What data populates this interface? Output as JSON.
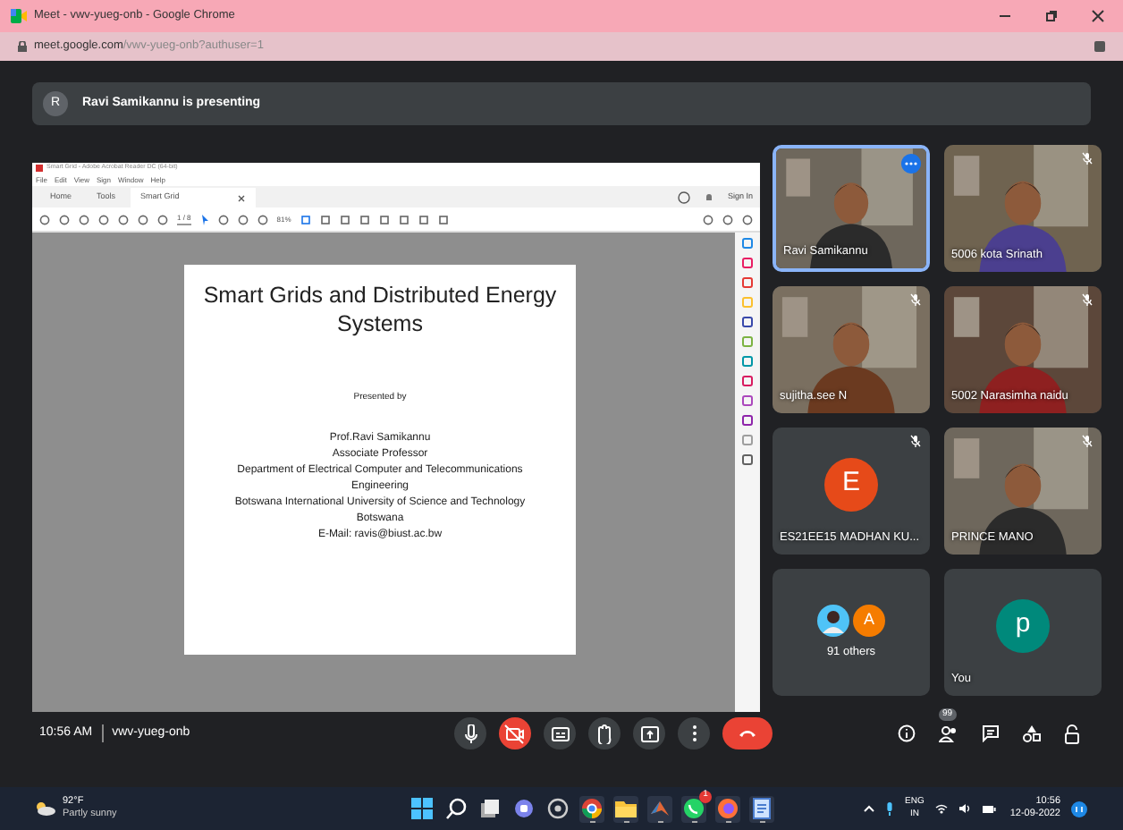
{
  "browser": {
    "title": "Meet - vwv-yueg-onb - Google Chrome",
    "url_host": "meet.google.com",
    "url_path": "/vwv-yueg-onb?authuser=1"
  },
  "banner": {
    "avatar": "R",
    "text": "Ravi Samikannu is presenting"
  },
  "shared_screen": {
    "app_title": "Smart Grid - Adobe Acrobat Reader DC (64-bit)",
    "menu": [
      "File",
      "Edit",
      "View",
      "Sign",
      "Window",
      "Help"
    ],
    "tabs": [
      {
        "label": "Home",
        "selected": false
      },
      {
        "label": "Tools",
        "selected": false
      },
      {
        "label": "Smart Grid",
        "selected": true
      }
    ],
    "sign_in": "Sign In",
    "page": "1 / 8",
    "zoom": "81%",
    "slide": {
      "title": "Smart Grids and Distributed Energy Systems",
      "presented_by": "Presented by",
      "lines": [
        "Prof.Ravi Samikannu",
        "Associate Professor",
        "Department of Electrical Computer and Telecommunications Engineering",
        "Botswana International University of Science and Technology",
        "Botswana",
        "E-Mail: ravis@biust.ac.bw"
      ]
    }
  },
  "tiles": [
    {
      "kind": "video",
      "name": "Ravi Samikannu",
      "active": true,
      "muted": false
    },
    {
      "kind": "video",
      "name": "5006 kota Srinath",
      "active": false,
      "muted": true
    },
    {
      "kind": "video",
      "name": "sujitha.see N",
      "active": false,
      "muted": true
    },
    {
      "kind": "video",
      "name": "5002 Narasimha naidu",
      "active": false,
      "muted": true
    },
    {
      "kind": "avatar",
      "name": "ES21EE15 MADHAN KU...",
      "letter": "E",
      "color": "#e64a19",
      "active": false,
      "muted": true
    },
    {
      "kind": "video",
      "name": "PRINCE MANO",
      "active": false,
      "muted": true
    },
    {
      "kind": "others",
      "name": "91 others",
      "letter": "A",
      "color": "#f57c00",
      "active": false,
      "muted": false
    },
    {
      "kind": "avatar",
      "name": "You",
      "letter": "p",
      "color": "#00897b",
      "active": false,
      "muted": false
    }
  ],
  "call_bar": {
    "time": "10:56 AM",
    "meeting_code": "vwv-yueg-onb",
    "buttons": [
      {
        "kind": "mic",
        "off": false
      },
      {
        "kind": "camera",
        "off": true
      },
      {
        "kind": "captions",
        "off": false
      },
      {
        "kind": "hand",
        "off": false
      },
      {
        "kind": "present",
        "off": false
      },
      {
        "kind": "more",
        "off": false
      },
      {
        "kind": "leave"
      }
    ],
    "people_count": "99"
  },
  "taskbar": {
    "temperature": "92°F",
    "weather": "Partly sunny",
    "apps": [
      {
        "kind": "start",
        "running": false
      },
      {
        "kind": "search",
        "running": false
      },
      {
        "kind": "taskview",
        "running": false
      },
      {
        "kind": "chat",
        "running": false
      },
      {
        "kind": "obs",
        "running": false
      },
      {
        "kind": "browser",
        "running": true
      },
      {
        "kind": "folder",
        "running": true
      },
      {
        "kind": "matlab",
        "running": true
      },
      {
        "kind": "whatsapp",
        "running": true,
        "badge": "1"
      },
      {
        "kind": "firefox",
        "running": true
      },
      {
        "kind": "notepad",
        "running": true
      }
    ],
    "language": "ENG",
    "region": "IN",
    "time": "10:56",
    "date": "12-09-2022"
  }
}
